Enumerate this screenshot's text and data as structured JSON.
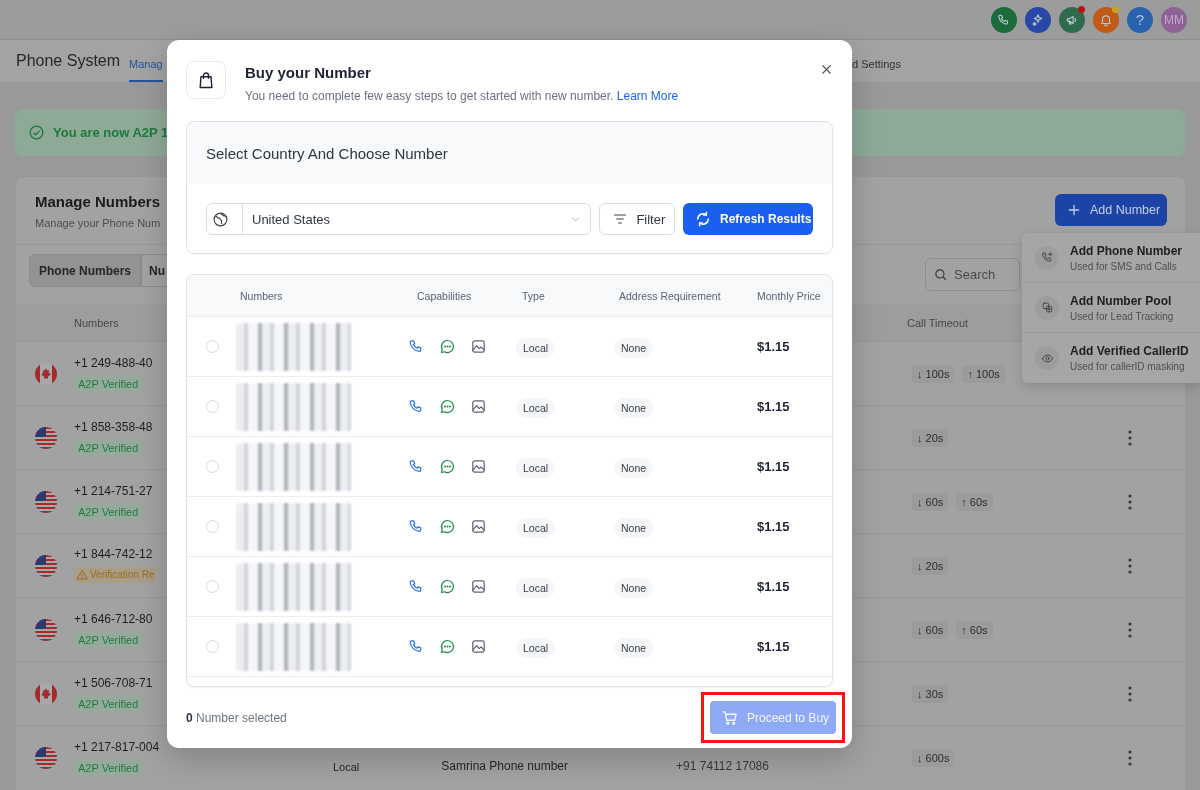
{
  "topbar": {
    "icons": [
      {
        "kind": "phone",
        "dot": false
      },
      {
        "kind": "sparkle",
        "dot": false
      },
      {
        "kind": "megaphone",
        "dot": true
      },
      {
        "kind": "bell",
        "dot": true
      },
      {
        "kind": "help",
        "dot": false,
        "glyph": "?"
      }
    ],
    "avatar": "MM"
  },
  "header": {
    "title": "Phone System",
    "tabs": [
      {
        "label": "Manag",
        "selected": true
      },
      {
        "label": "d Settings",
        "selected": false
      }
    ]
  },
  "alert": {
    "text": "You are now A2P 1"
  },
  "card": {
    "title": "Manage Numbers",
    "subtitle": "Manage your Phone Num",
    "add_button": "Add Number",
    "segments": [
      {
        "label": "Phone Numbers",
        "selected": true
      },
      {
        "label": "Nu",
        "selected": false
      }
    ],
    "search": {
      "placeholder": "Search"
    },
    "columns": [
      "Numbers",
      "Call Timeout"
    ],
    "rows": [
      {
        "kind": "ca",
        "number": "+1 249-488-40",
        "status": {
          "kind": "verified",
          "label": "A2P Verified"
        },
        "timeouts": [
          "↓ 100s",
          "↑ 100s"
        ],
        "more": false
      },
      {
        "kind": "us",
        "number": "+1 858-358-48",
        "status": {
          "kind": "verified",
          "label": "A2P Verified"
        },
        "timeouts": [
          "↓ 20s"
        ],
        "more": true
      },
      {
        "kind": "us",
        "number": "+1 214-751-27",
        "status": {
          "kind": "verified",
          "label": "A2P Verified"
        },
        "timeouts": [
          "↓ 60s",
          "↑ 60s"
        ],
        "more": true
      },
      {
        "kind": "us",
        "number": "+1 844-742-12",
        "status": {
          "kind": "warning",
          "label": "Verification Re"
        },
        "timeouts": [
          "↓ 20s"
        ],
        "more": true
      },
      {
        "kind": "us",
        "number": "+1 646-712-80",
        "status": {
          "kind": "verified",
          "label": "A2P Verified"
        },
        "timeouts": [
          "↓ 60s",
          "↑ 60s"
        ],
        "more": true
      },
      {
        "kind": "ca",
        "number": "+1 506-708-71",
        "status": {
          "kind": "verified",
          "label": "A2P Verified"
        },
        "timeouts": [
          "↓ 30s"
        ],
        "more": true
      },
      {
        "kind": "us",
        "number": "+1 217-817-004",
        "status": {
          "kind": "verified",
          "label": "A2P Verified"
        },
        "type": "Local",
        "name": "Samrina Phone number",
        "forward": "+91 74112 17086",
        "timeouts": [
          "↓ 600s"
        ],
        "more": true
      }
    ]
  },
  "menu": {
    "items": [
      {
        "kind": "phone-plus",
        "title": "Add Phone Number",
        "subtitle": "Used for SMS and Calls"
      },
      {
        "kind": "pool",
        "title": "Add Number Pool",
        "subtitle": "Used for Lead Tracking"
      },
      {
        "kind": "eye",
        "title": "Add Verified CallerID",
        "subtitle": "Used for callerID masking"
      }
    ]
  },
  "modal": {
    "title": "Buy your Number",
    "subtitle": "You need to complete few easy steps to get started with new number.",
    "link": "Learn More",
    "section_title": "Select Country And Choose Number",
    "country": "United States",
    "filter_button": "Filter",
    "refresh_button": "Refresh Results",
    "columns": [
      "Numbers",
      "Capabilities",
      "Type",
      "Address Requirement",
      "Monthly Price"
    ],
    "rows": [
      {
        "selected": false,
        "type": "Local",
        "address": "None",
        "price": "$1.15"
      },
      {
        "selected": false,
        "type": "Local",
        "address": "None",
        "price": "$1.15"
      },
      {
        "selected": false,
        "type": "Local",
        "address": "None",
        "price": "$1.15"
      },
      {
        "selected": false,
        "type": "Local",
        "address": "None",
        "price": "$1.15"
      },
      {
        "selected": false,
        "type": "Local",
        "address": "None",
        "price": "$1.15"
      },
      {
        "selected": false,
        "type": "Local",
        "address": "None",
        "price": "$1.15"
      }
    ],
    "selection_text": "**0** Number selected",
    "proceed": {
      "label": "Proceed to Buy",
      "disabled": true,
      "highlighted": true
    }
  }
}
